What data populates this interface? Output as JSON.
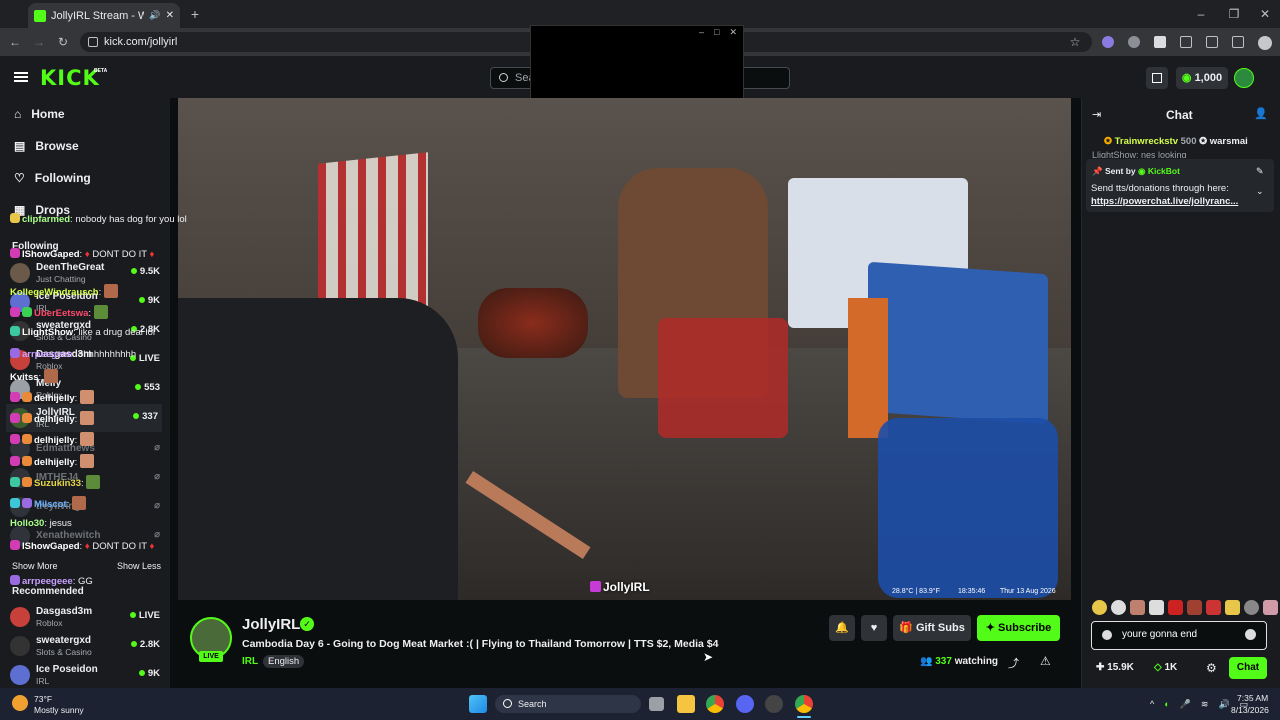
{
  "browser": {
    "tab_title": "JollyIRL Stream - Watch Liv",
    "url": "kick.com/jollyirl"
  },
  "header": {
    "logo": "KICK",
    "beta": "BETA",
    "search_placeholder": "Sea",
    "coins": "1,000"
  },
  "sidebar": {
    "nav": [
      {
        "label": "Home"
      },
      {
        "label": "Browse"
      },
      {
        "label": "Following"
      },
      {
        "label": "Drops"
      }
    ],
    "following_title": "Following",
    "following": [
      {
        "name": "DeenTheGreat",
        "category": "Just Chatting",
        "viewers": "9.5K"
      },
      {
        "name": "Ice Poseidon",
        "category": "IRL",
        "viewers": "9K"
      },
      {
        "name": "sweatergxd",
        "category": "Slots & Casino",
        "viewers": "2.8K"
      },
      {
        "name": "Dasgasd3m",
        "category": "Roblox",
        "viewers": "LIVE"
      },
      {
        "name": "Melly",
        "category": "Roblox",
        "viewers": "553"
      },
      {
        "name": "JollyIRL",
        "category": "IRL",
        "viewers": "337"
      }
    ],
    "offline": [
      {
        "name": "Edmatthews"
      },
      {
        "name": "IMTHEJ4"
      },
      {
        "name": "treyliving"
      },
      {
        "name": "Xenathewitch"
      }
    ],
    "show_more": "Show More",
    "show_less": "Show Less",
    "recommended_title": "Recommended",
    "recommended": [
      {
        "name": "Dasgasd3m",
        "category": "Roblox",
        "viewers": "LIVE"
      },
      {
        "name": "sweatergxd",
        "category": "Slots & Casino",
        "viewers": "2.8K"
      },
      {
        "name": "Ice Poseidon",
        "category": "IRL",
        "viewers": "9K"
      }
    ]
  },
  "video": {
    "watermark": "JollyIRL",
    "overlay_temp": "28.8°C | 83.9°F",
    "overlay_time": "18:35:46",
    "overlay_date": "Thur 13 Aug 2026"
  },
  "stream": {
    "channel": "JollyIRL",
    "live_badge": "LIVE",
    "title": "Cambodia Day 6 - Going to Dog Meat Market :( | Flying to Thailand Tomorrow | TTS $2, Media $4",
    "tags": [
      "IRL",
      "English"
    ],
    "gift_subs": "Gift Subs",
    "subscribe": "Subscribe",
    "watching_count": "337",
    "watching_label": "watching"
  },
  "chat": {
    "title": "Chat",
    "top_gifter1": "Trainwreckstv",
    "top_gifter1_amount": "500",
    "top_gifter2": "warsmai",
    "cut_message": "LlightShow: nes looking",
    "pinned_sent_by": "Sent by",
    "pinned_author": "KickBot",
    "pinned_text": "Send tts/donations through here:",
    "pinned_link": "https://powerchat.live/jollyranc...",
    "messages": [
      {
        "user": "clipfarmed",
        "text": "nobody has dog for you lol"
      },
      {
        "user": "IShowGaped",
        "text": "DONT DO IT"
      },
      {
        "user": "KollegeWindrausch",
        "text": ""
      },
      {
        "user": "UberEetswa",
        "text": ""
      },
      {
        "user": "LlightShow",
        "text": "like a drug deal lol"
      },
      {
        "user": "arrpeegeee",
        "text": "ohhhhhhhhhh"
      },
      {
        "user": "Kvitss",
        "text": ""
      },
      {
        "user": "delhijelly",
        "text": ""
      },
      {
        "user": "delhijelly",
        "text": ""
      },
      {
        "user": "delhijelly",
        "text": ""
      },
      {
        "user": "delhijelly",
        "text": ""
      },
      {
        "user": "Suzukin33",
        "text": ""
      },
      {
        "user": "Milscot",
        "text": ""
      },
      {
        "user": "Hollo30",
        "text": "jesus"
      },
      {
        "user": "IShowGaped",
        "text": "DONT DO IT"
      },
      {
        "user": "arrpeegeee",
        "text": "GG"
      }
    ],
    "input_value": "youre gonna end",
    "followers": "15.9K",
    "subs": "1K",
    "send": "Chat"
  },
  "taskbar": {
    "weather_temp": "73°F",
    "weather_desc": "Mostly sunny",
    "search": "Search",
    "time": "7:35 AM",
    "date": "8/13/2026"
  },
  "colors": {
    "accent": "#53fc18",
    "bg": "#0b0e0f",
    "panel": "#191b1f"
  }
}
